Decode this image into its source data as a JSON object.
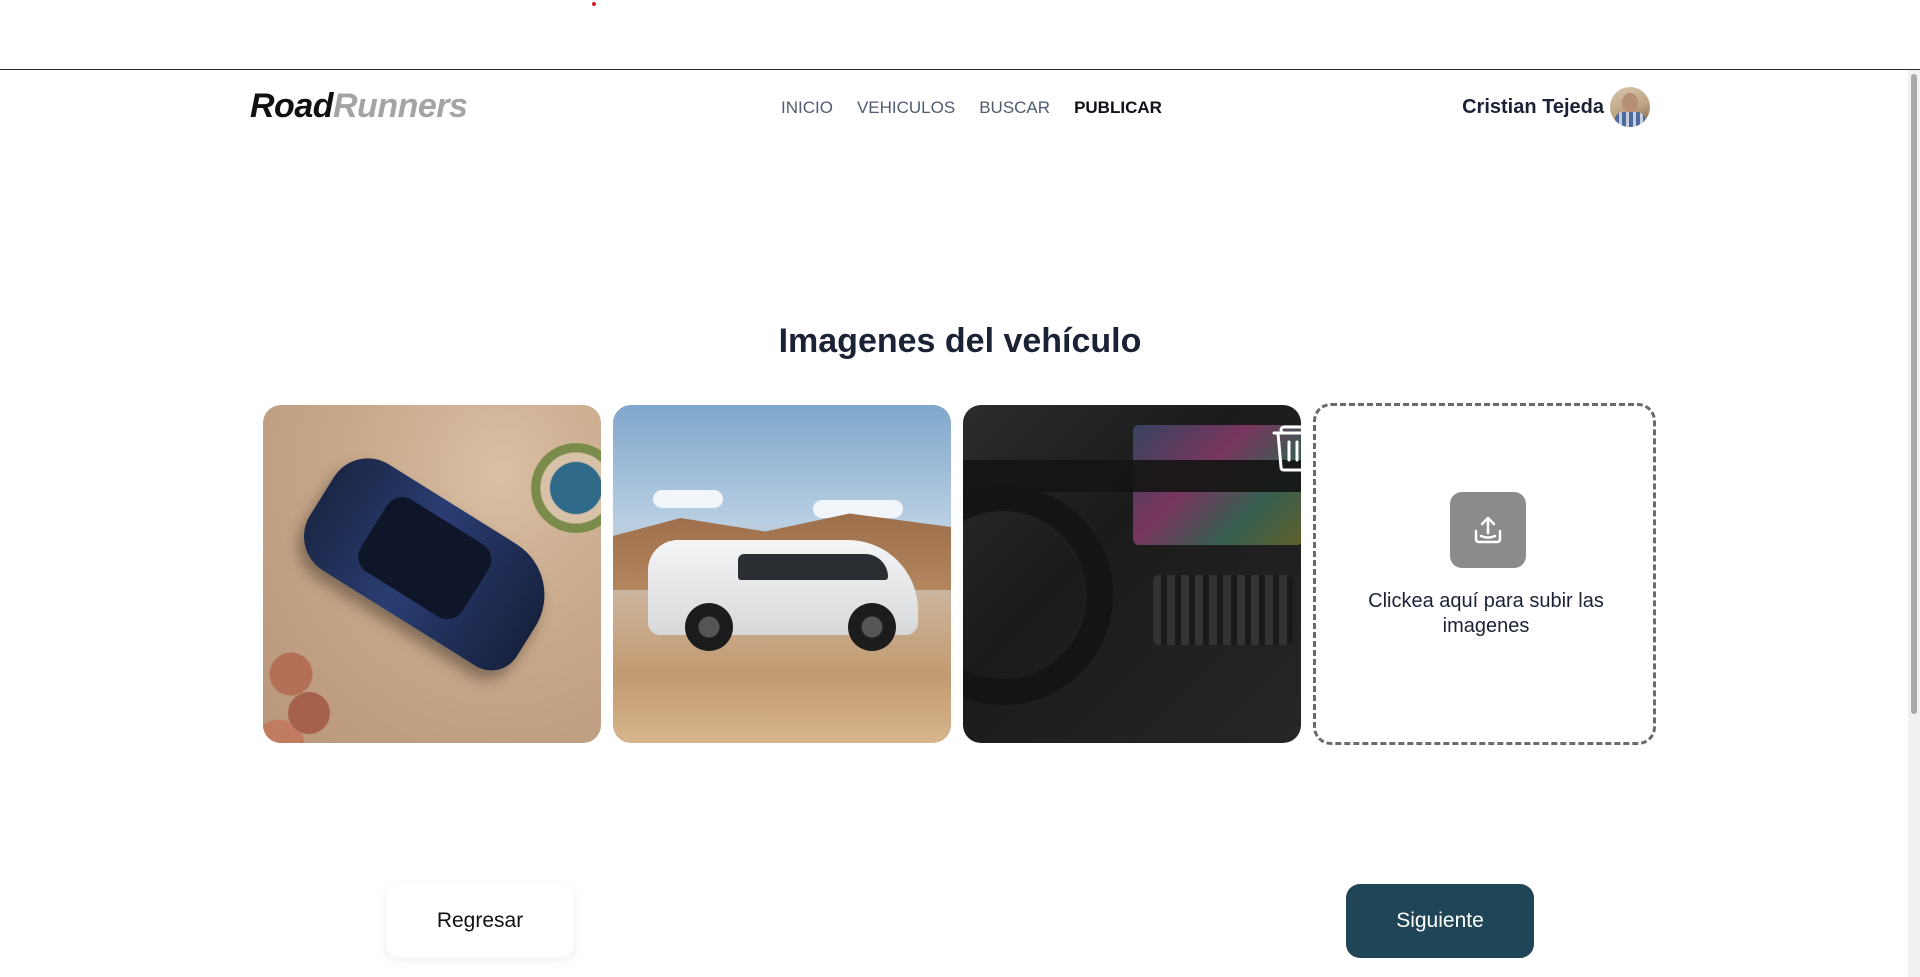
{
  "brand": {
    "part1": "Road",
    "part2": "Runners"
  },
  "nav": {
    "items": [
      "INICIO",
      "VEHICULOS",
      "BUSCAR",
      "PUBLICAR"
    ],
    "active": "PUBLICAR"
  },
  "user": {
    "name": "Cristian Tejeda"
  },
  "page": {
    "title": "Imagenes del vehículo"
  },
  "gallery": {
    "images": [
      "suv-blue-aerial",
      "suv-white-desert",
      "interior-dashboard"
    ],
    "upload_text": "Clickea aquí para subir las imagenes"
  },
  "actions": {
    "back_label": "Regresar",
    "next_label": "Siguiente"
  },
  "colors": {
    "accent": "#1f4557",
    "upload_icon_bg": "#8b8b8b",
    "text": "#1b2236"
  }
}
